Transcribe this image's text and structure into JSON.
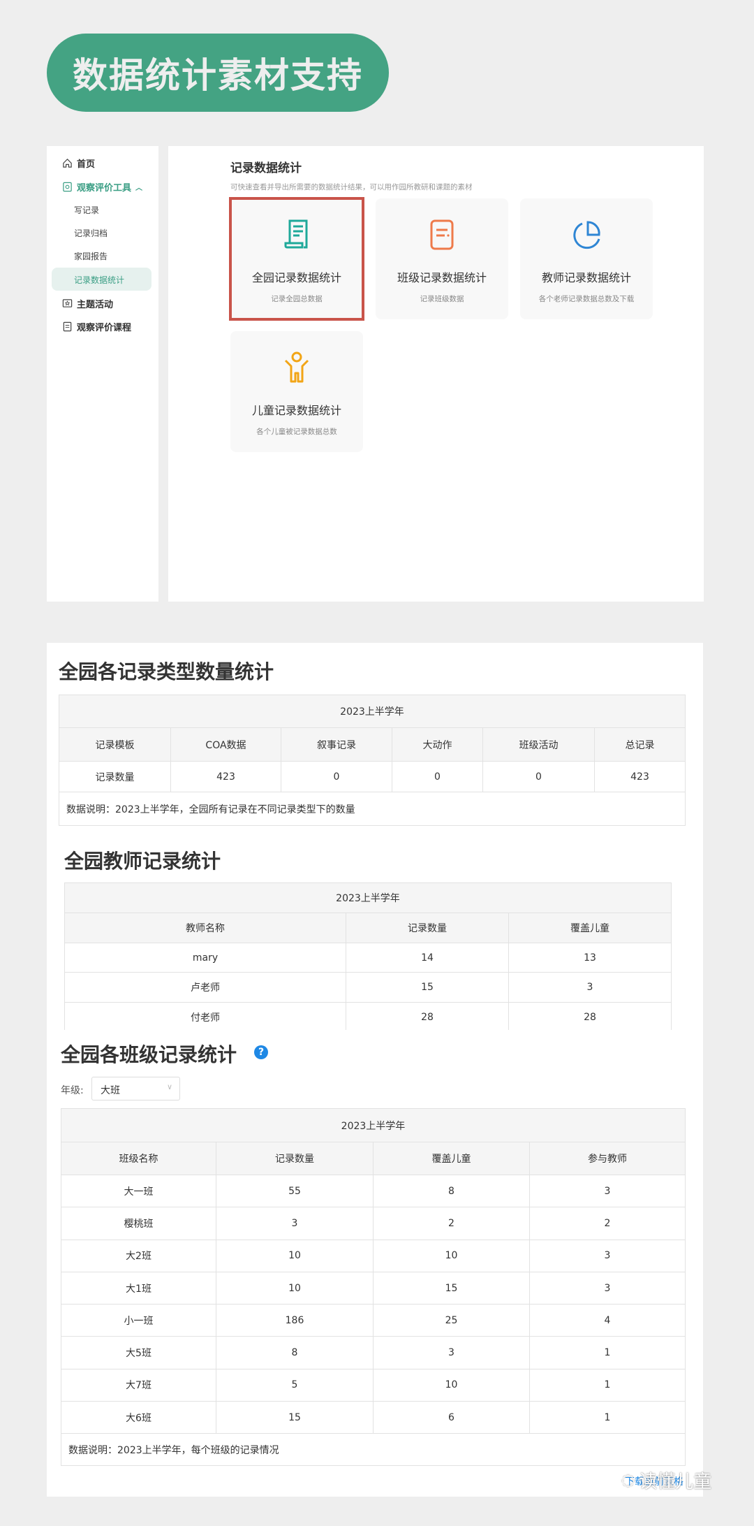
{
  "banner": {
    "title": "数据统计素材支持",
    "color": "#44a383"
  },
  "sidebar": {
    "items": [
      {
        "label": "首页",
        "icon": "home-icon"
      },
      {
        "label": "观察评价工具",
        "icon": "observe-icon",
        "expanded": true
      },
      {
        "label": "写记录"
      },
      {
        "label": "记录归档"
      },
      {
        "label": "家园报告"
      },
      {
        "label": "记录数据统计",
        "active": true
      },
      {
        "label": "主题活动",
        "icon": "star-board-icon"
      },
      {
        "label": "观察评价课程",
        "icon": "course-icon"
      }
    ]
  },
  "main": {
    "title": "记录数据统计",
    "subtitle": "可快速查看并导出所需要的数据统计结果，可以用作园所教研和课题的素材",
    "cards": [
      {
        "title": "全园记录数据统计",
        "desc": "记录全园总数据",
        "icon": "scroll-icon",
        "color": "#1fa99a",
        "selected": true
      },
      {
        "title": "班级记录数据统计",
        "desc": "记录班级数据",
        "icon": "document-icon",
        "color": "#ee7a4a"
      },
      {
        "title": "教师记录数据统计",
        "desc": "各个老师记录数据总数及下载",
        "icon": "pie-chart-icon",
        "color": "#2f86d4"
      },
      {
        "title": "儿童记录数据统计",
        "desc": "各个儿童被记录数据总数",
        "icon": "child-icon",
        "color": "#f2a516"
      }
    ]
  },
  "type_stats": {
    "title": "全园各记录类型数量统计",
    "period": "2023上半学年",
    "headers": [
      "记录模板",
      "COA数据",
      "叙事记录",
      "大动作",
      "班级活动",
      "总记录"
    ],
    "row": [
      "记录数量",
      "423",
      "0",
      "0",
      "0",
      "423"
    ],
    "note": "数据说明：2023上半学年，全园所有记录在不同记录类型下的数量"
  },
  "teacher_stats": {
    "title": "全园教师记录统计",
    "period": "2023上半学年",
    "headers": [
      "教师名称",
      "记录数量",
      "覆盖儿童"
    ],
    "rows": [
      [
        "mary",
        "14",
        "13"
      ],
      [
        "卢老师",
        "15",
        "3"
      ],
      [
        "付老师",
        "28",
        "28"
      ]
    ]
  },
  "class_stats": {
    "title": "全园各班级记录统计",
    "grade_label": "年级:",
    "grade_value": "大班",
    "period": "2023上半学年",
    "headers": [
      "班级名称",
      "记录数量",
      "覆盖儿童",
      "参与教师"
    ],
    "rows": [
      [
        "大一班",
        "55",
        "8",
        "3"
      ],
      [
        "樱桃班",
        "3",
        "2",
        "2"
      ],
      [
        "大2班",
        "10",
        "10",
        "3"
      ],
      [
        "大1班",
        "10",
        "15",
        "3"
      ],
      [
        "小一班",
        "186",
        "25",
        "4"
      ],
      [
        "大5班",
        "8",
        "3",
        "1"
      ],
      [
        "大7班",
        "5",
        "10",
        "1"
      ],
      [
        "大6班",
        "15",
        "6",
        "1"
      ]
    ],
    "note": "数据说明：2023上半学年，每个班级的记录情况",
    "download": "下载当前表格"
  },
  "watermark": "读懂儿童"
}
